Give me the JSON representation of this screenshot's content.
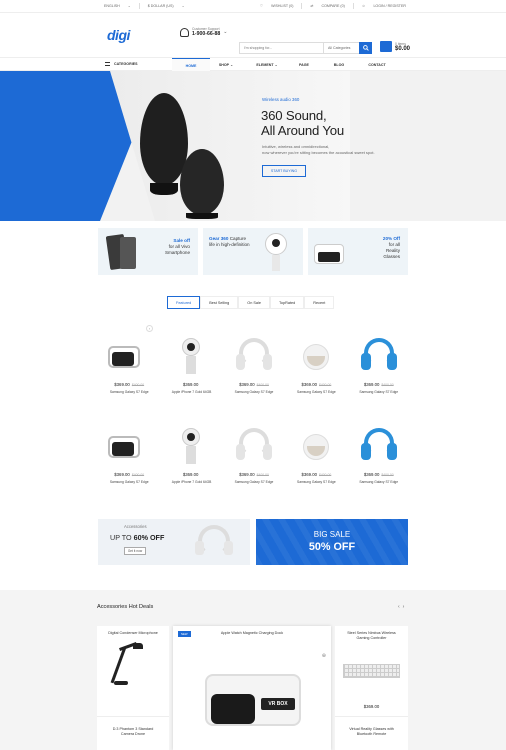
{
  "topbar": {
    "language": "ENGLISH",
    "currency": "$ DOLLAR (US)",
    "wishlist": "WISHLIST (0)",
    "compare": "COMPARE (0)",
    "login": "LOGIN / REGISTER"
  },
  "header": {
    "logo": "digi",
    "support_label": "Customer Support",
    "support_phone": "1-900-66-88",
    "search_placeholder": "I'm shopping for...",
    "search_category": "All Categories",
    "cart_items": "0 items",
    "cart_total": "$0.00"
  },
  "nav": {
    "categories": "CATEGORIES",
    "items": [
      "HOME",
      "SHOP",
      "ELEMENT",
      "PAGE",
      "BLOG",
      "CONTACT"
    ]
  },
  "hero": {
    "subtitle": "Wireless audio 360",
    "title_line1": "360 Sound,",
    "title_line2": "All Around You",
    "desc_line1": "Intuitive, wireless and omnidirectional,",
    "desc_line2": "now wherever you're sitting becomes the acoustical sweet spot.",
    "button": "START BUYING"
  },
  "promos": [
    {
      "highlight": "Sale off",
      "text1": "for all Vivo",
      "text2": "Smartphone"
    },
    {
      "highlight": "Gear 360",
      "text0": "Capture",
      "text1": "life in high-definition",
      "text2": ""
    },
    {
      "highlight": "20% Off",
      "text1": "for all",
      "text2": "Reality",
      "text3": "Glasses"
    }
  ],
  "tabs": [
    "Featured",
    "Best Selling",
    "On Sale",
    "TopRated",
    "Recent"
  ],
  "products_row1": [
    {
      "price": "$369.00",
      "old": "$400.00",
      "name": "Samsung Galaxy S7 Edge",
      "icon": "vr-headset"
    },
    {
      "price": "$369.00",
      "old": "",
      "name": "Apple iPhone 7 Gold 64GB",
      "icon": "gear-360"
    },
    {
      "price": "$369.00",
      "old": "$400.00",
      "name": "Samsung Galaxy S7 Edge",
      "icon": "white-headphones"
    },
    {
      "price": "$369.00",
      "old": "$400.00",
      "name": "Samsung Galaxy S7 Edge",
      "icon": "smart-speaker"
    },
    {
      "price": "$369.00",
      "old": "$400.00",
      "name": "Samsung Galaxy S7 Edge",
      "icon": "blue-headphones"
    }
  ],
  "products_row2": [
    {
      "price": "$369.00",
      "old": "$400.00",
      "name": "Samsung Galaxy S7 Edge",
      "icon": "vr-headset"
    },
    {
      "price": "$369.00",
      "old": "",
      "name": "Apple iPhone 7 Gold 64GB",
      "icon": "gear-360"
    },
    {
      "price": "$369.00",
      "old": "$400.00",
      "name": "Samsung Galaxy S7 Edge",
      "icon": "white-headphones"
    },
    {
      "price": "$369.00",
      "old": "$400.00",
      "name": "Samsung Galaxy S7 Edge",
      "icon": "smart-speaker"
    },
    {
      "price": "$369.00",
      "old": "$400.00",
      "name": "Samsung Galaxy S7 Edge",
      "icon": "blue-headphones"
    }
  ],
  "banners": {
    "left_label": "Accessories",
    "left_upto": "UP TO ",
    "left_pct": "60% OFF",
    "left_button": "Get it now",
    "right_line1": "BIG SALE",
    "right_line2": "50% OFF"
  },
  "hot_deals": {
    "title": "Accessories Hot Deals",
    "card1_title": "Digital Condenser Microphone",
    "card1_bottom_line1": "D.3 Phantom 3 Standard",
    "card1_bottom_line2": "Camera Drone",
    "card2_badge": "NEW",
    "card2_title": "Apple Watch Magnetic Charging Dock",
    "card2_vr_brand": "VR BOX",
    "card3_title_line1": "Steel Series Nimbus Wireless",
    "card3_title_line2": "Gaming Controller",
    "card3_price": "$369.00",
    "card3_bottom_line1": "Virtual Reality Glasses with",
    "card3_bottom_line2": "Bluetooth Remote"
  },
  "colors": {
    "accent": "#1d6ad5"
  }
}
